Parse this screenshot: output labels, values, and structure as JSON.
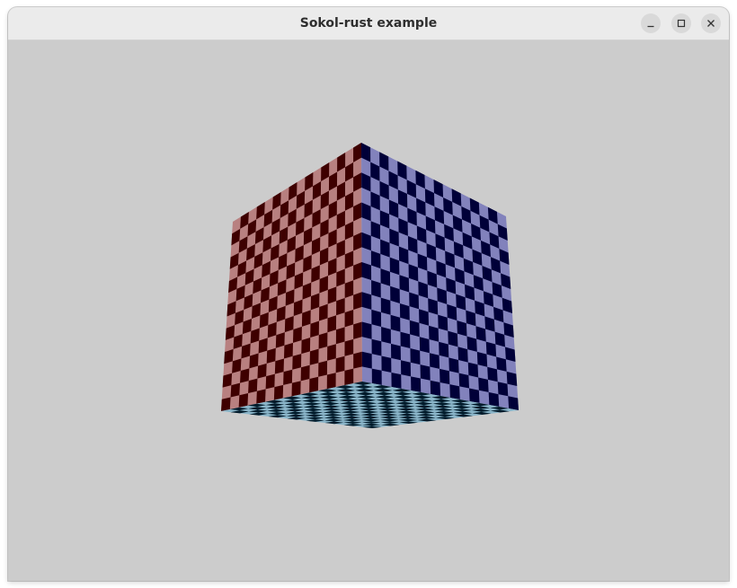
{
  "window": {
    "title": "Sokol-rust example",
    "controls": {
      "minimize_icon": "minimize-icon",
      "maximize_icon": "maximize-icon",
      "close_icon": "close-icon"
    }
  },
  "scene": {
    "background_color": "#cccccc",
    "object": "textured-cube",
    "texture": "checkerboard",
    "faces": [
      {
        "name": "left-face",
        "light": "#b88080",
        "dark": "#3e0000"
      },
      {
        "name": "right-face",
        "light": "#8282bc",
        "dark": "#000038"
      },
      {
        "name": "bottom-face",
        "light": "#8ab5c9",
        "dark": "#001a2a"
      }
    ]
  }
}
